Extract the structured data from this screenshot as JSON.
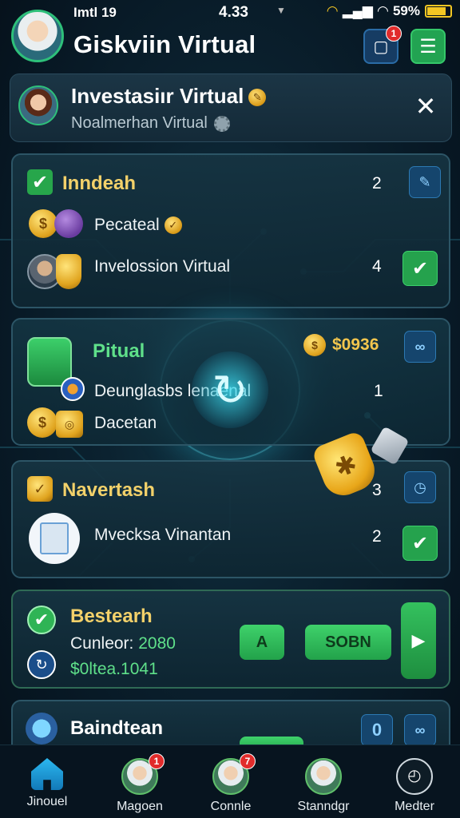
{
  "status_bar": {
    "left_text": "Imtl 19",
    "time": "4.33",
    "battery": "59%"
  },
  "header": {
    "title": "Giskviin Virtual",
    "notification_count": "1"
  },
  "banner": {
    "title": "Investasiır Virtual",
    "subtitle": "Noalmerhan Virtual"
  },
  "card1": {
    "title": "Inndeah",
    "title_count": "2",
    "rows": [
      {
        "label": "Pecateal",
        "count": ""
      },
      {
        "label": "Invelossion Virtual",
        "count": "4"
      }
    ]
  },
  "card2": {
    "title": "Pitual",
    "amount": "$0936",
    "rows": [
      {
        "label": "Deunglasbs lenaenal",
        "count": "1"
      },
      {
        "label": "Dacetan",
        "count": ""
      }
    ]
  },
  "card3": {
    "title": "Navertash",
    "title_count": "3",
    "rows": [
      {
        "label": "Mvecksa Vinantan",
        "count": "2"
      }
    ]
  },
  "card4": {
    "title": "Bestearh",
    "line1_label": "Cunleor:",
    "line1_value": "2080",
    "line2_value": "$0ltea.1041",
    "btn_a": "A",
    "btn_main": "SOBN"
  },
  "card5": {
    "title": "Baindtean",
    "count": "0"
  },
  "bottom_nav": [
    {
      "label": "Jinouel",
      "badge": ""
    },
    {
      "label": "Magoen",
      "badge": "1"
    },
    {
      "label": "Connle",
      "badge": "7"
    },
    {
      "label": "Stanndgr",
      "badge": ""
    },
    {
      "label": "Medter",
      "badge": ""
    }
  ],
  "colors": {
    "accent_green": "#27a64b",
    "accent_gold": "#f3d16a",
    "accent_blue": "#15456d",
    "badge_red": "#e12b2b"
  },
  "icons": [
    "signal-icon",
    "wifi-icon",
    "battery-icon",
    "notification-icon",
    "menu-icon",
    "close-icon",
    "check-icon",
    "coin-icon",
    "home-icon",
    "clock-icon"
  ]
}
